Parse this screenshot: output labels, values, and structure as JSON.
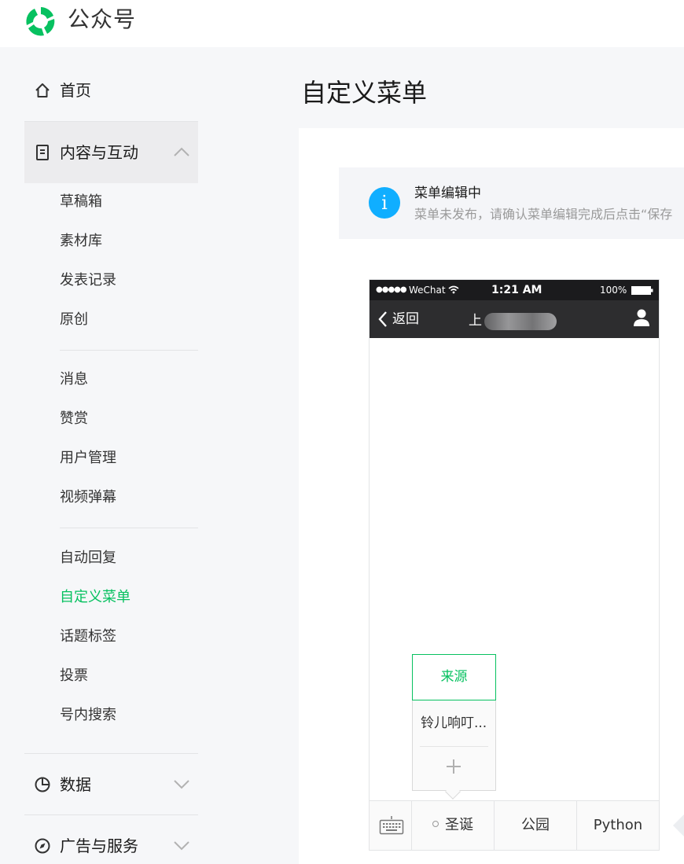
{
  "app": {
    "title": "公众号",
    "brand_color": "#07c160"
  },
  "sidebar": {
    "home": {
      "label": "首页",
      "icon": "home-icon"
    },
    "content_group": {
      "label": "内容与互动",
      "icon": "document-icon",
      "expanded": true,
      "sections": [
        [
          "草稿箱",
          "素材库",
          "发表记录",
          "原创"
        ],
        [
          "消息",
          "赞赏",
          "用户管理",
          "视频弹幕"
        ],
        [
          "自动回复",
          "自定义菜单",
          "话题标签",
          "投票",
          "号内搜索"
        ]
      ],
      "active_item": "自定义菜单"
    },
    "data": {
      "label": "数据",
      "icon": "pie-chart-icon"
    },
    "ads": {
      "label": "广告与服务",
      "icon": "compass-icon"
    }
  },
  "main": {
    "page_title": "自定义菜单",
    "notice": {
      "icon": "info-icon",
      "title": "菜单编辑中",
      "desc": "菜单未发布，请确认菜单编辑完成后点击“保存"
    }
  },
  "phone": {
    "status": {
      "signal": "●●●●●",
      "carrier": "WeChat",
      "time": "1:21 AM",
      "battery": "100%"
    },
    "nav": {
      "back": "返回",
      "account_name": "上"
    },
    "submenu": {
      "active": "来源",
      "items": [
        "铃儿响叮..."
      ]
    },
    "menu": [
      "圣诞",
      "公园",
      "Python"
    ]
  }
}
